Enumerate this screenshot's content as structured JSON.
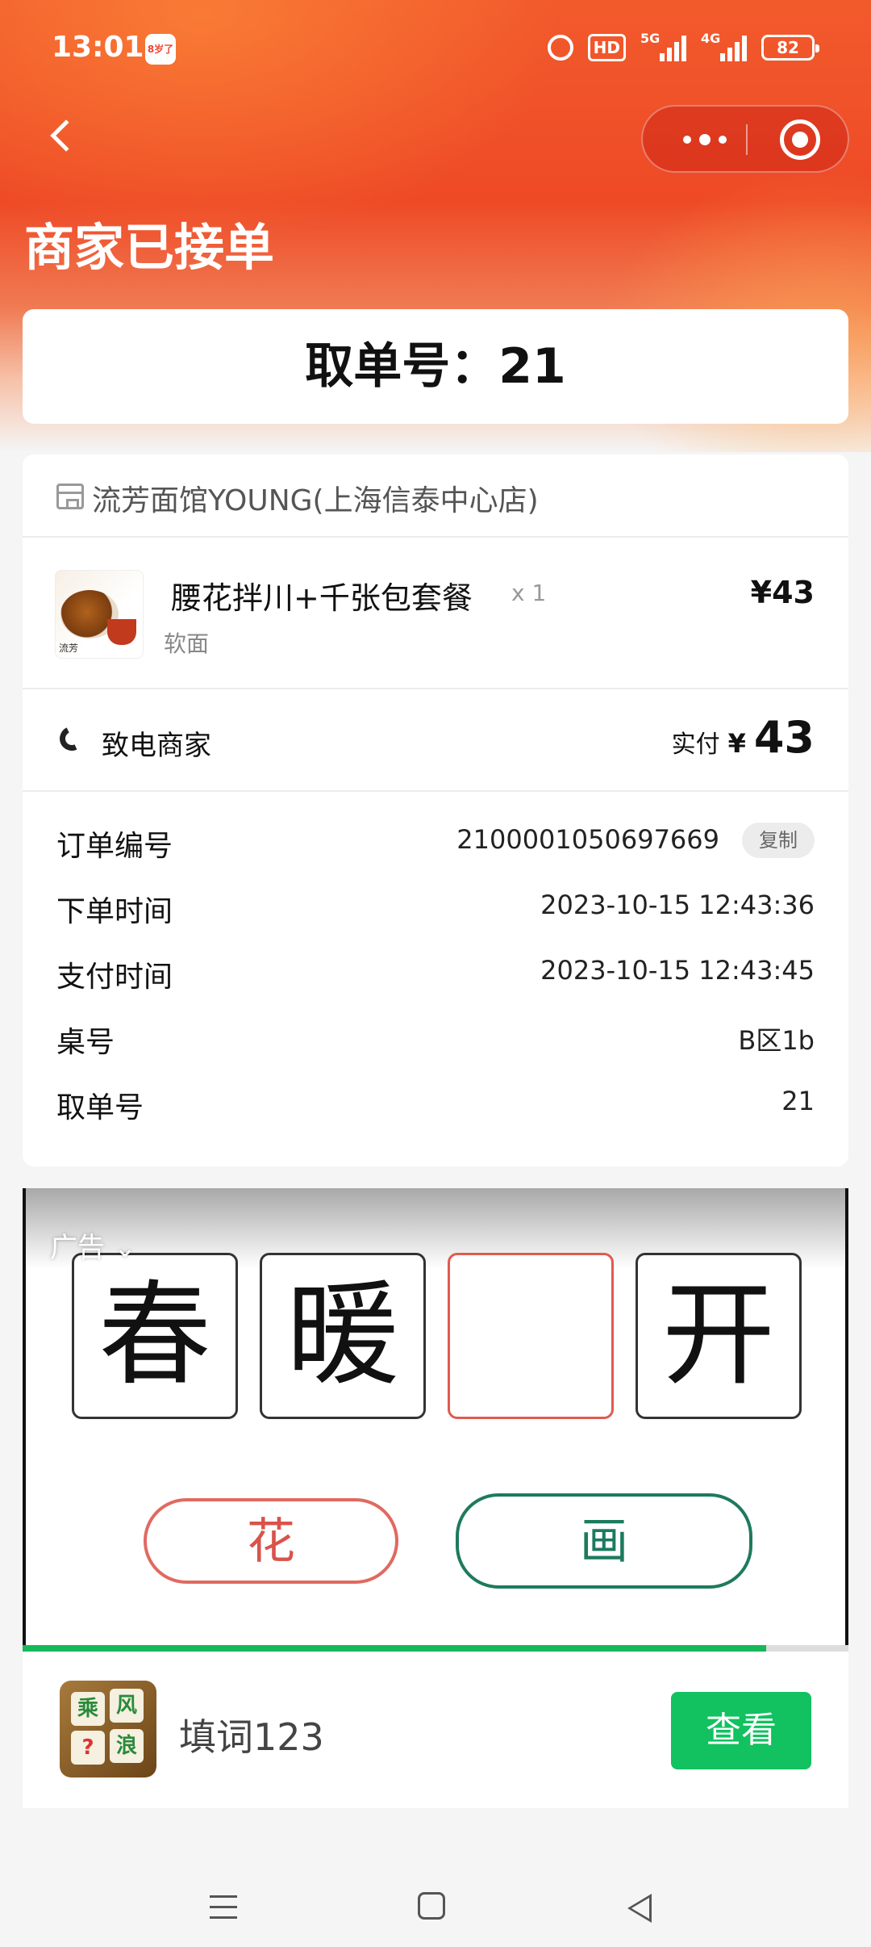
{
  "status_bar": {
    "time": "13:01",
    "app_badge": "8岁了",
    "hd": "HD",
    "signal1": "5G",
    "signal2": "4G",
    "battery": "82"
  },
  "nav": {
    "title": "商家已接单"
  },
  "pickup": {
    "text": "取单号：21"
  },
  "store": {
    "name": "流芳面馆YOUNG(上海信泰中心店)"
  },
  "item": {
    "name": "腰花拌川+千张包套餐",
    "qty": "x 1",
    "spec": "软面",
    "price": "¥43",
    "thumb_tag": "流芳"
  },
  "call": {
    "label": "致电商家",
    "paid_label": "实付",
    "currency": "¥",
    "amount": "43"
  },
  "details": [
    {
      "key": "订单编号",
      "value": "2100001050697669",
      "copy": "复制"
    },
    {
      "key": "下单时间",
      "value": "2023-10-15 12:43:36"
    },
    {
      "key": "支付时间",
      "value": "2023-10-15 12:43:45"
    },
    {
      "key": "桌号",
      "value": "B区1b"
    },
    {
      "key": "取单号",
      "value": "21"
    }
  ],
  "ad": {
    "label": "广告",
    "tiles": [
      "春",
      "暖",
      "",
      "开"
    ],
    "option_left": "花",
    "option_right": "画",
    "progress": 0.9,
    "game_name": "填词123",
    "game_icon_tiles": [
      "乘",
      "风",
      "?",
      "浪"
    ],
    "view_button": "查看"
  },
  "colors": {
    "header": "#ee4a26",
    "accent_green": "#12c160",
    "tile_blank": "#e05a50",
    "option_green": "#1d7a5e"
  }
}
